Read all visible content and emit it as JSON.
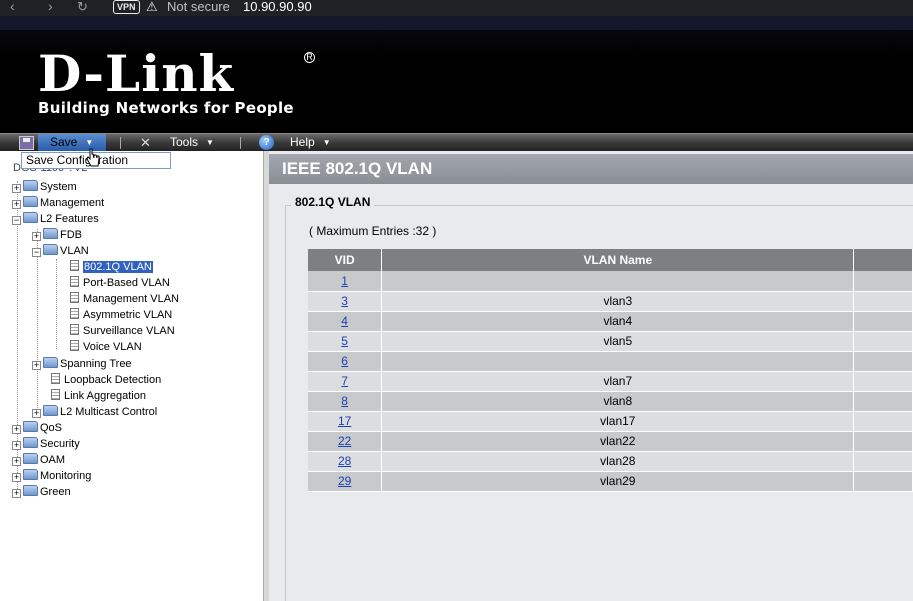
{
  "browser": {
    "vpn_label": "VPN",
    "security_text": "Not secure",
    "url": "10.90.90.90"
  },
  "header": {
    "brand": "D-Link",
    "tagline": "Building Networks for People"
  },
  "menu": {
    "save_label": "Save",
    "tools_label": "Tools",
    "help_label": "Help",
    "dropdown_item": "Save Configuration"
  },
  "tree": {
    "root": "DGS-1100-?V2",
    "items": [
      {
        "label": "System"
      },
      {
        "label": "Management"
      },
      {
        "label": "L2 Features"
      },
      {
        "label": "FDB"
      },
      {
        "label": "VLAN"
      },
      {
        "label": "802.1Q VLAN"
      },
      {
        "label": "Port-Based VLAN"
      },
      {
        "label": "Management VLAN"
      },
      {
        "label": "Asymmetric VLAN"
      },
      {
        "label": "Surveillance VLAN"
      },
      {
        "label": "Voice VLAN"
      },
      {
        "label": "Spanning Tree"
      },
      {
        "label": "Loopback Detection"
      },
      {
        "label": "Link Aggregation"
      },
      {
        "label": "L2 Multicast Control"
      },
      {
        "label": "QoS"
      },
      {
        "label": "Security"
      },
      {
        "label": "OAM"
      },
      {
        "label": "Monitoring"
      },
      {
        "label": "Green"
      }
    ]
  },
  "content": {
    "title": "IEEE 802.1Q VLAN",
    "section": "802.1Q VLAN",
    "max_entries": "( Maximum Entries :32 )",
    "columns": [
      "VID",
      "VLAN Name"
    ],
    "rows": [
      {
        "vid": "1",
        "name": ""
      },
      {
        "vid": "3",
        "name": "vlan3"
      },
      {
        "vid": "4",
        "name": "vlan4"
      },
      {
        "vid": "5",
        "name": "vlan5"
      },
      {
        "vid": "6",
        "name": ""
      },
      {
        "vid": "7",
        "name": "vlan7"
      },
      {
        "vid": "8",
        "name": "vlan8"
      },
      {
        "vid": "17",
        "name": "vlan17"
      },
      {
        "vid": "22",
        "name": "vlan22"
      },
      {
        "vid": "28",
        "name": "vlan28"
      },
      {
        "vid": "29",
        "name": "vlan29"
      }
    ]
  }
}
